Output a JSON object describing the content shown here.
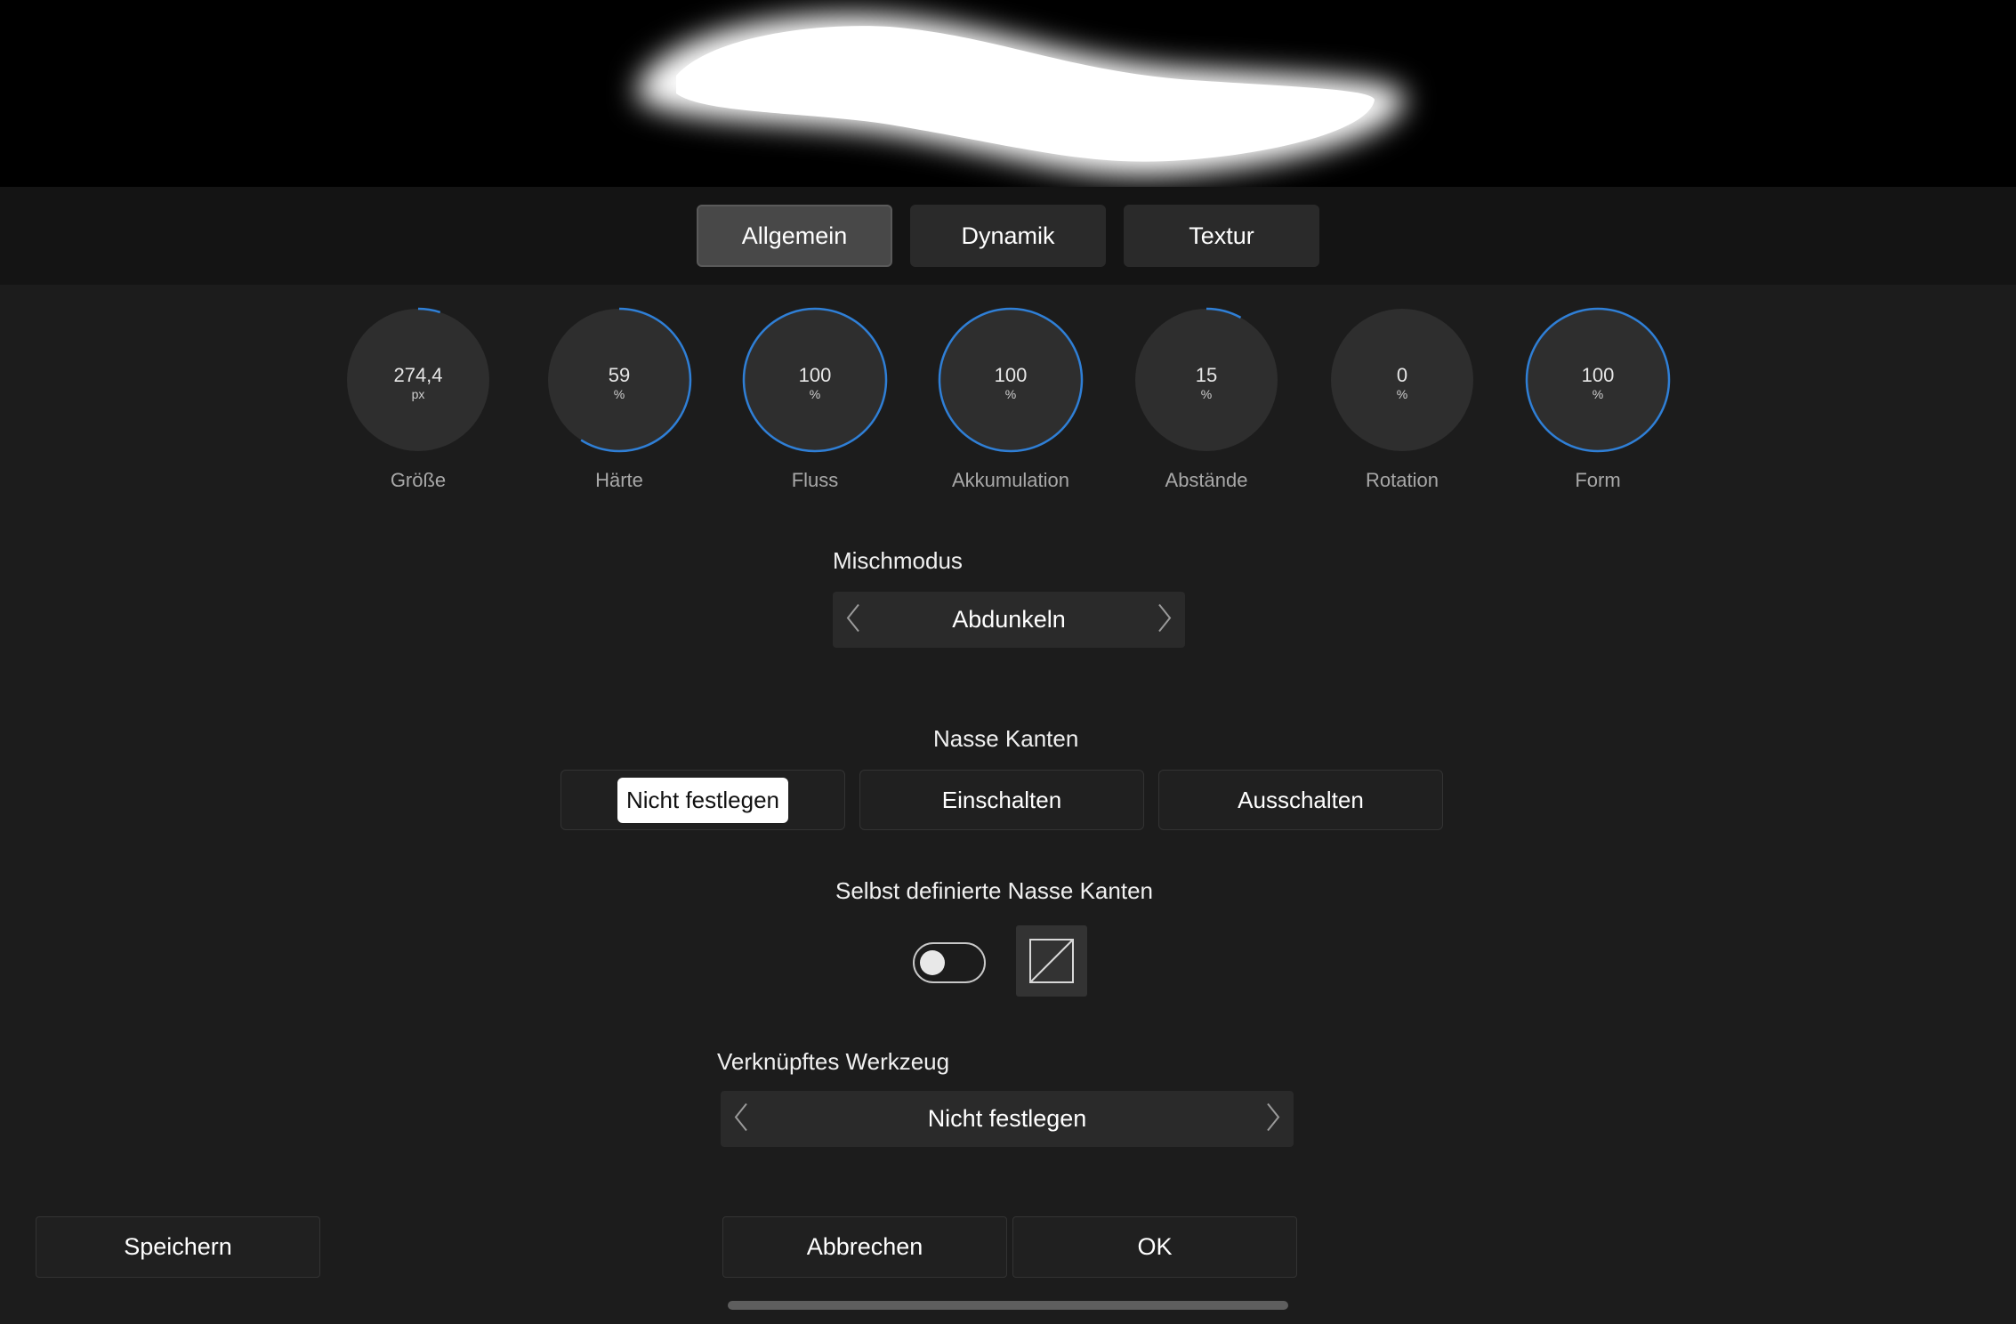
{
  "colors": {
    "accent": "#2f7fd6",
    "background": "#1c1c1c",
    "tab_bar": "#141414",
    "control": "#2a2a2a"
  },
  "tabs": [
    {
      "label": "Allgemein",
      "active": true
    },
    {
      "label": "Dynamik",
      "active": false
    },
    {
      "label": "Textur",
      "active": false
    }
  ],
  "dials": [
    {
      "value": "274,4",
      "unit": "px",
      "label": "Größe",
      "fraction": 0.05
    },
    {
      "value": "59",
      "unit": "%",
      "label": "Härte",
      "fraction": 0.59
    },
    {
      "value": "100",
      "unit": "%",
      "label": "Fluss",
      "fraction": 1.0
    },
    {
      "value": "100",
      "unit": "%",
      "label": "Akkumulation",
      "fraction": 1.0
    },
    {
      "value": "15",
      "unit": "%",
      "label": "Abstände",
      "fraction": 0.08
    },
    {
      "value": "0",
      "unit": "%",
      "label": "Rotation",
      "fraction": 0.0
    },
    {
      "value": "100",
      "unit": "%",
      "label": "Form",
      "fraction": 1.0
    }
  ],
  "blend_mode": {
    "label": "Mischmodus",
    "value": "Abdunkeln"
  },
  "wet_edges": {
    "label": "Nasse Kanten",
    "options": [
      "Nicht festlegen",
      "Einschalten",
      "Ausschalten"
    ],
    "selected": "Nicht festlegen"
  },
  "custom_wet_edges": {
    "label": "Selbst definierte Nasse Kanten",
    "enabled": false
  },
  "linked_tool": {
    "label": "Verknüpftes Werkzeug",
    "value": "Nicht festlegen"
  },
  "footer": {
    "save_label": "Speichern",
    "cancel_label": "Abbrechen",
    "ok_label": "OK"
  }
}
